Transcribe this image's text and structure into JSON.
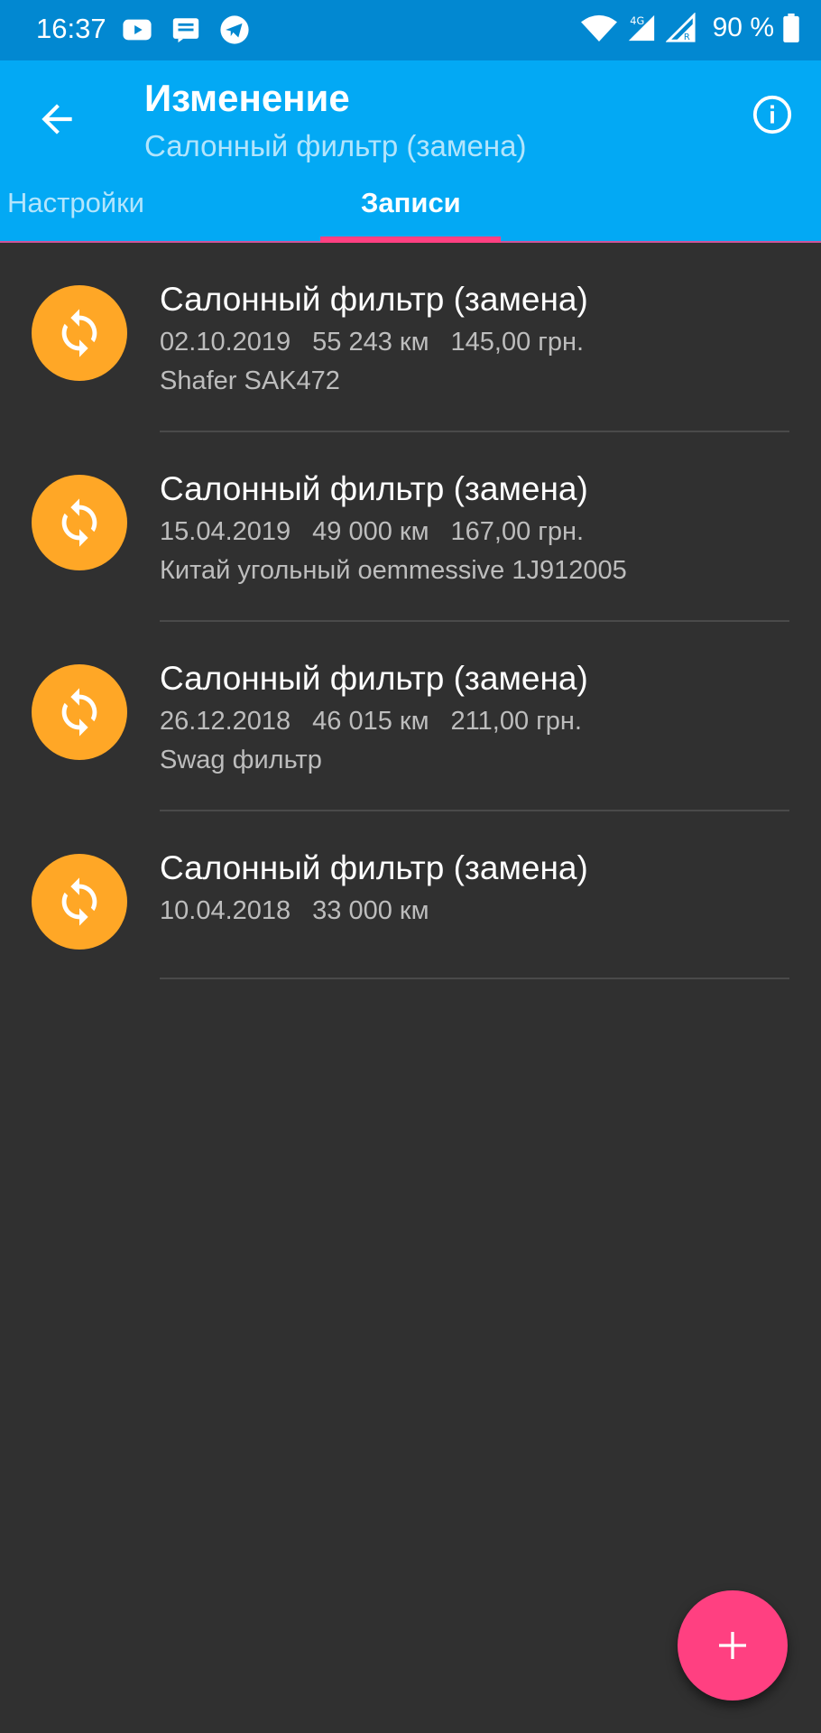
{
  "status_bar": {
    "time": "16:37",
    "battery": "90 %",
    "icons_left": [
      "youtube-icon",
      "message-icon",
      "telegram-icon"
    ],
    "icons_right": [
      "wifi-icon",
      "signal-4g-icon",
      "signal-roaming-icon",
      "battery-icon"
    ]
  },
  "app_bar": {
    "back_icon": "arrow-left-icon",
    "title": "Изменение",
    "subtitle": "Салонный фильтр (замена)",
    "info_icon": "info-icon"
  },
  "tabs": [
    {
      "label": "Настройки",
      "active": false
    },
    {
      "label": "Записи",
      "active": true
    }
  ],
  "records": [
    {
      "icon": "refresh-icon",
      "title": "Салонный фильтр (замена)",
      "date": "02.10.2019",
      "mileage": "55 243 км",
      "cost": "145,00 грн.",
      "note": "Shafer SAK472"
    },
    {
      "icon": "refresh-icon",
      "title": "Салонный фильтр (замена)",
      "date": "15.04.2019",
      "mileage": "49 000 км",
      "cost": "167,00 грн.",
      "note": "Китай угольный oemmessive 1J912005"
    },
    {
      "icon": "refresh-icon",
      "title": "Салонный фильтр (замена)",
      "date": "26.12.2018",
      "mileage": "46 015 км",
      "cost": "211,00 грн.",
      "note": "Swag фильтр"
    },
    {
      "icon": "refresh-icon",
      "title": "Салонный фильтр (замена)",
      "date": "10.04.2018",
      "mileage": "33 000 км",
      "cost": "",
      "note": ""
    }
  ],
  "fab": {
    "icon": "plus-icon"
  },
  "colors": {
    "status_bar": "#0288d1",
    "app_bar": "#03a9f4",
    "accent": "#ff4081",
    "icon_bg": "#ffa726",
    "background": "#303030"
  }
}
